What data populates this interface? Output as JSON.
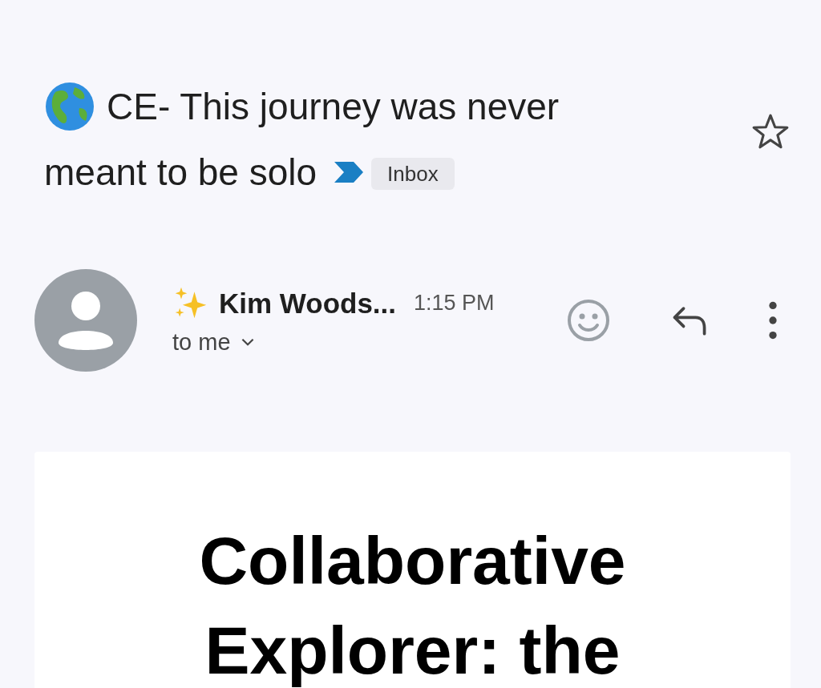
{
  "subject": {
    "lines": [
      "CE- This journey was never",
      "meant to be solo"
    ],
    "important": true,
    "label": "Inbox",
    "starred": false
  },
  "message": {
    "sender": "Kim Woods...",
    "time": "1:15 PM",
    "recipient": "to me"
  },
  "body": {
    "heading": "Collaborative Explorer: the"
  }
}
